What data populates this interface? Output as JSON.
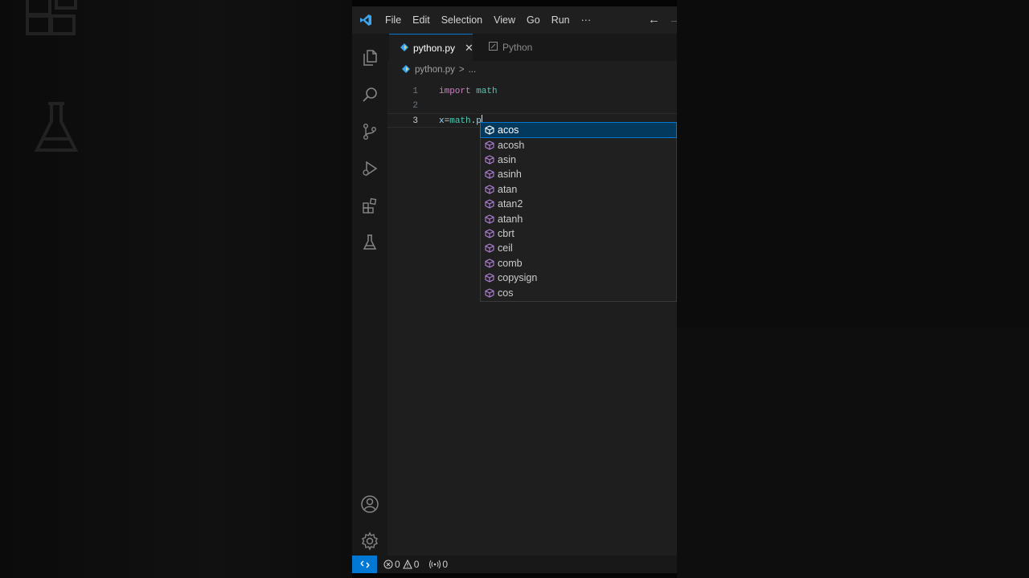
{
  "menu": {
    "items": [
      "File",
      "Edit",
      "Selection",
      "View",
      "Go",
      "Run"
    ],
    "more": "···",
    "back": "←",
    "forward": "→"
  },
  "tabs": [
    {
      "label": "python.py",
      "active": true
    },
    {
      "label": "Python",
      "active": false
    }
  ],
  "breadcrumb": {
    "file": "python.py",
    "sep": ">",
    "rest": "..."
  },
  "editor": {
    "lines": [
      {
        "num": "1",
        "tokens": [
          "import",
          " math"
        ]
      },
      {
        "num": "2",
        "tokens": [
          ""
        ]
      },
      {
        "num": "3",
        "tokens": [
          "x",
          "=",
          "math",
          ".",
          "p"
        ]
      }
    ]
  },
  "suggestions": {
    "selected_index": 0,
    "items": [
      "acos",
      "acosh",
      "asin",
      "asinh",
      "atan",
      "atan2",
      "atanh",
      "cbrt",
      "ceil",
      "comb",
      "copysign",
      "cos"
    ]
  },
  "status": {
    "errors": "0",
    "warnings": "0",
    "ports": "0"
  },
  "colors": {
    "accent": "#0078d4",
    "keyword": "#c586c0",
    "module": "#4ec9b0",
    "selection": "#04395e",
    "symbol_icon": "#b180d7"
  }
}
